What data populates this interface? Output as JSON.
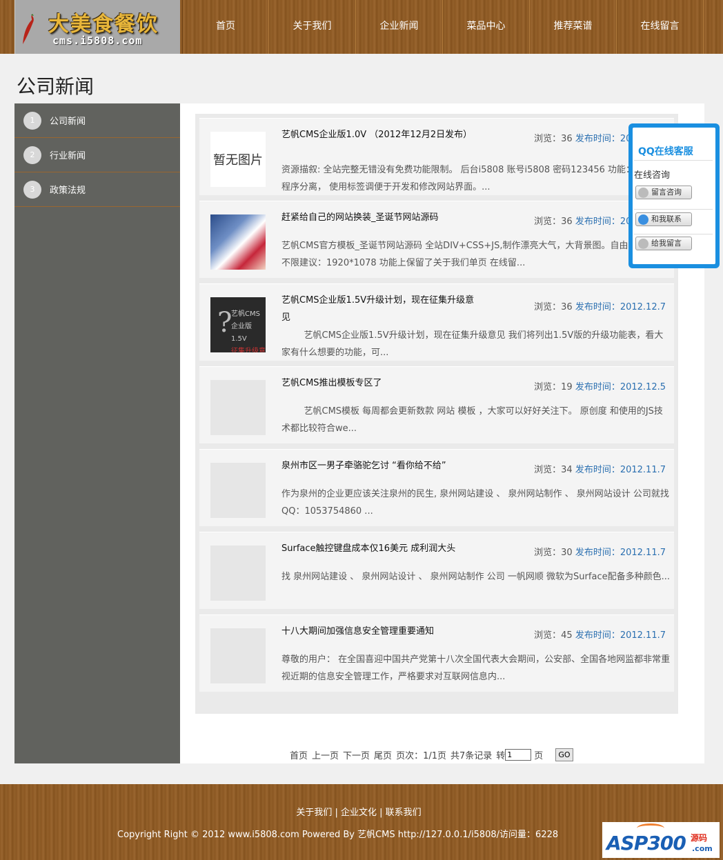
{
  "logo": {
    "title": "大美食餐饮",
    "sub": "cms.i5808.com"
  },
  "nav": [
    "首页",
    "关于我们",
    "企业新闻",
    "菜品中心",
    "推荐菜谱",
    "在线留言"
  ],
  "page_title": "公司新闻",
  "sidebar": [
    {
      "num": "1",
      "label": "公司新闻"
    },
    {
      "num": "2",
      "label": "行业新闻"
    },
    {
      "num": "3",
      "label": "政策法规"
    }
  ],
  "news": [
    {
      "thumb": "暂无图片",
      "title": "艺帆CMS企业版1.0V （2012年12月2日发布）",
      "views_label": "浏览：",
      "views": "36",
      "date_label": "发布时间：",
      "date": "2012.12.2",
      "summary": "资源描叙: 全站完整无错没有免费功能限制。 后台i5808 账号i5808 密码123456 功能： 模板和程序分离， 使用标签调便于开发和修改网站界面。..."
    },
    {
      "thumb": "",
      "title": "赶紧给自己的网站换装_圣诞节网站源码",
      "views_label": "浏览：",
      "views": "36",
      "date_label": "发布时间：",
      "date": "2012.12.7",
      "summary": "艺帆CMS官方模板_圣诞节网站源码 全站DIV+CSS+JS,制作漂亮大气，大背景图。自由更换 大小不限建议：1920*1078 功能上保留了关于我们单页 在线留..."
    },
    {
      "thumb": "",
      "title": "艺帆CMS企业版1.5V升级计划，现在征集升级意见",
      "views_label": "浏览：",
      "views": "36",
      "date_label": "发布时间：",
      "date": "2012.12.7",
      "summary": "艺帆CMS企业版1.5V升级计划，现在征集升级意见 我们将列出1.5V版的升级功能表，看大家有什么想要的功能，可..."
    },
    {
      "thumb": "",
      "title": "艺帆CMS推出模板专区了",
      "views_label": "浏览：",
      "views": "19",
      "date_label": "发布时间：",
      "date": "2012.12.5",
      "summary": "艺帆CMS模板 每周都会更新数款 网站 模板 ，大家可以好好关注下。 原创度 和使用的JS技术都比较符合we..."
    },
    {
      "thumb": "",
      "title": "泉州市区一男子牵骆驼乞讨 “看你给不给”",
      "views_label": "浏览：",
      "views": "34",
      "date_label": "发布时间：",
      "date": "2012.11.7",
      "summary": "作为泉州的企业更应该关注泉州的民生, 泉州网站建设 、 泉州网站制作 、 泉州网站设计 公司就找QQ：1053754860 ..."
    },
    {
      "thumb": "",
      "title": "Surface触控键盘成本仅16美元 成利润大头",
      "views_label": "浏览：",
      "views": "30",
      "date_label": "发布时间：",
      "date": "2012.11.7",
      "summary": "找 泉州网站建设 、 泉州网站设计 、 泉州网站制作 公司 一帆网顺 微软为Surface配备多种颜色..."
    },
    {
      "thumb": "",
      "title": "十八大期间加强信息安全管理重要通知",
      "views_label": "浏览：",
      "views": "45",
      "date_label": "发布时间：",
      "date": "2012.11.7",
      "summary": "尊敬的用户： 在全国喜迎中国共产党第十八次全国代表大会期间，公安部、全国各地网监都非常重视近期的信息安全管理工作，严格要求对互联网信息内..."
    }
  ],
  "thumb3": {
    "l1": "艺帆CMS",
    "l2": "企业版1.5V",
    "l3": "征集升级意见"
  },
  "qq": {
    "head": "QQ在线客服",
    "sub": "在线咨询",
    "btn1": "留言咨询",
    "btn2": "和我联系",
    "btn3": "给我留言"
  },
  "pager": {
    "first": "首页",
    "prev": "上一页",
    "next": "下一页",
    "last": "尾页",
    "pages": "页次：1/1页",
    "total": "共7条记录",
    "goto": "转",
    "page_input": "1",
    "unit": "页",
    "go": "GO"
  },
  "footer": {
    "link1": "关于我们",
    "link2": "企业文化",
    "link3": "联系我们",
    "copy": "Copyright Right © 2012 www.i5808.com Powered By 艺帆CMS http://127.0.0.1/i5808/访问量：6228"
  },
  "badge": {
    "main": "ASP300",
    "top": "源码",
    "bottom": ".com"
  }
}
